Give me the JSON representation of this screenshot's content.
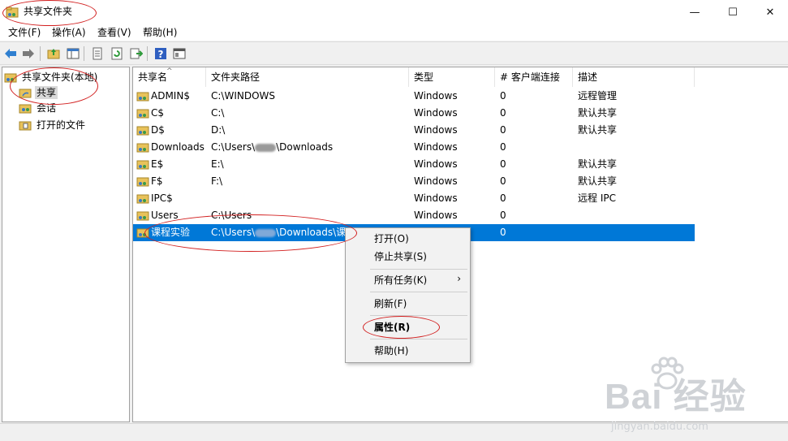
{
  "window": {
    "title": "共享文件夹",
    "minimize_glyph": "—",
    "maximize_glyph": "☐",
    "close_glyph": "✕"
  },
  "menu": [
    "文件(F)",
    "操作(A)",
    "查看(V)",
    "帮助(H)"
  ],
  "toolbar": {
    "icons": [
      "back-icon",
      "forward-icon",
      "up-folder-icon",
      "show-tree-icon",
      "properties-icon",
      "refresh-icon",
      "export-icon",
      "help-icon",
      "view-icon"
    ]
  },
  "tree": {
    "root": "共享文件夹(本地)",
    "items": [
      "共享",
      "会话",
      "打开的文件"
    ],
    "selected": "共享"
  },
  "columns": [
    "共享名",
    "文件夹路径",
    "类型",
    "# 客户端连接",
    "描述"
  ],
  "rows": [
    {
      "name": "ADMIN$",
      "path": "C:\\WINDOWS",
      "type": "Windows",
      "clients": "0",
      "desc": "远程管理"
    },
    {
      "name": "C$",
      "path": "C:\\",
      "type": "Windows",
      "clients": "0",
      "desc": "默认共享"
    },
    {
      "name": "D$",
      "path": "D:\\",
      "type": "Windows",
      "clients": "0",
      "desc": "默认共享"
    },
    {
      "name": "Downloads",
      "path_prefix": "C:\\Users\\",
      "path_suffix": "\\Downloads",
      "type": "Windows",
      "clients": "0",
      "desc": ""
    },
    {
      "name": "E$",
      "path": "E:\\",
      "type": "Windows",
      "clients": "0",
      "desc": "默认共享"
    },
    {
      "name": "F$",
      "path": "F:\\",
      "type": "Windows",
      "clients": "0",
      "desc": "默认共享"
    },
    {
      "name": "IPC$",
      "path": "",
      "type": "Windows",
      "clients": "0",
      "desc": "远程 IPC"
    },
    {
      "name": "Users",
      "path": "C:\\Users",
      "type": "Windows",
      "clients": "0",
      "desc": ""
    },
    {
      "name": "课程实验",
      "path_prefix": "C:\\Users\\",
      "path_suffix": "\\Downloads\\课",
      "type": "",
      "clients": "0",
      "desc": ""
    }
  ],
  "context_menu": {
    "open": "打开(O)",
    "stop_sharing": "停止共享(S)",
    "all_tasks": "所有任务(K)",
    "submenu_arrow": "›",
    "refresh": "刷新(F)",
    "properties": "属性(R)",
    "help": "帮助(H)"
  },
  "watermark": {
    "main": "Bai 经验",
    "sub": "jingyan.baidu.com"
  },
  "colors": {
    "selection": "#0078d7",
    "annotation": "#d21f1f"
  }
}
